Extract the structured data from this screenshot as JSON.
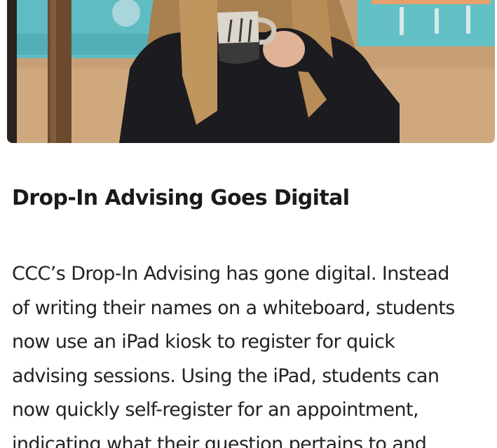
{
  "article": {
    "hero_image": {
      "icon": "photo-woman-drinking-from-mug",
      "colors": {
        "floor": "#c9a37a",
        "wall_teal": "#57b9c1",
        "shirt": "#1b1b1f",
        "hair": "#b48a55",
        "skin": "#e2b59a"
      }
    },
    "title": "Drop-In Advising Goes Digital",
    "body_lines": [
      "CCC’s Drop-In Advising has gone digital. Instead",
      "of writing their names on a whiteboard, students",
      "now use an iPad kiosk to register for quick",
      "advising sessions. Using the iPad, students can",
      "now quickly self-register for an appointment,",
      "indicating what their question pertains to and"
    ]
  }
}
